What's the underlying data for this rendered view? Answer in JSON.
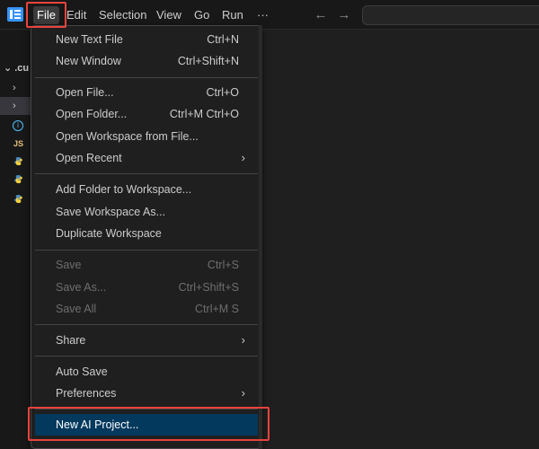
{
  "menubar": {
    "items": [
      {
        "label": "File"
      },
      {
        "label": "Edit"
      },
      {
        "label": "Selection"
      },
      {
        "label": "View"
      },
      {
        "label": "Go"
      },
      {
        "label": "Run"
      },
      {
        "label": "···"
      }
    ],
    "back_icon": "arrow-left-icon",
    "forward_icon": "arrow-right-icon"
  },
  "explorer": {
    "title": ".cu",
    "rows": [
      {
        "icon": "chevron-right-icon"
      },
      {
        "icon": "chevron-right-icon"
      },
      {
        "icon": "info-icon"
      },
      {
        "icon": "js-file-icon",
        "glyph": "JS"
      },
      {
        "icon": "python-file-icon"
      },
      {
        "icon": "python-file-icon"
      },
      {
        "icon": "python-file-icon"
      }
    ]
  },
  "file_menu": {
    "groups": [
      [
        {
          "label": "New Text File",
          "shortcut": "Ctrl+N"
        },
        {
          "label": "New Window",
          "shortcut": "Ctrl+Shift+N"
        }
      ],
      [
        {
          "label": "Open File...",
          "shortcut": "Ctrl+O"
        },
        {
          "label": "Open Folder...",
          "shortcut": "Ctrl+M Ctrl+O"
        },
        {
          "label": "Open Workspace from File...",
          "shortcut": ""
        },
        {
          "label": "Open Recent",
          "shortcut": "",
          "submenu": true
        }
      ],
      [
        {
          "label": "Add Folder to Workspace...",
          "shortcut": ""
        },
        {
          "label": "Save Workspace As...",
          "shortcut": ""
        },
        {
          "label": "Duplicate Workspace",
          "shortcut": ""
        }
      ],
      [
        {
          "label": "Save",
          "shortcut": "Ctrl+S",
          "disabled": true
        },
        {
          "label": "Save As...",
          "shortcut": "Ctrl+Shift+S",
          "disabled": true
        },
        {
          "label": "Save All",
          "shortcut": "Ctrl+M S",
          "disabled": true
        }
      ],
      [
        {
          "label": "Share",
          "shortcut": "",
          "submenu": true
        }
      ],
      [
        {
          "label": "Auto Save",
          "shortcut": ""
        },
        {
          "label": "Preferences",
          "shortcut": "",
          "submenu": true
        }
      ],
      [
        {
          "label": "New AI Project...",
          "shortcut": "",
          "highlighted": true
        }
      ]
    ]
  },
  "colors": {
    "accent_highlight": "#04395e",
    "annotation_red": "#e8433e"
  }
}
